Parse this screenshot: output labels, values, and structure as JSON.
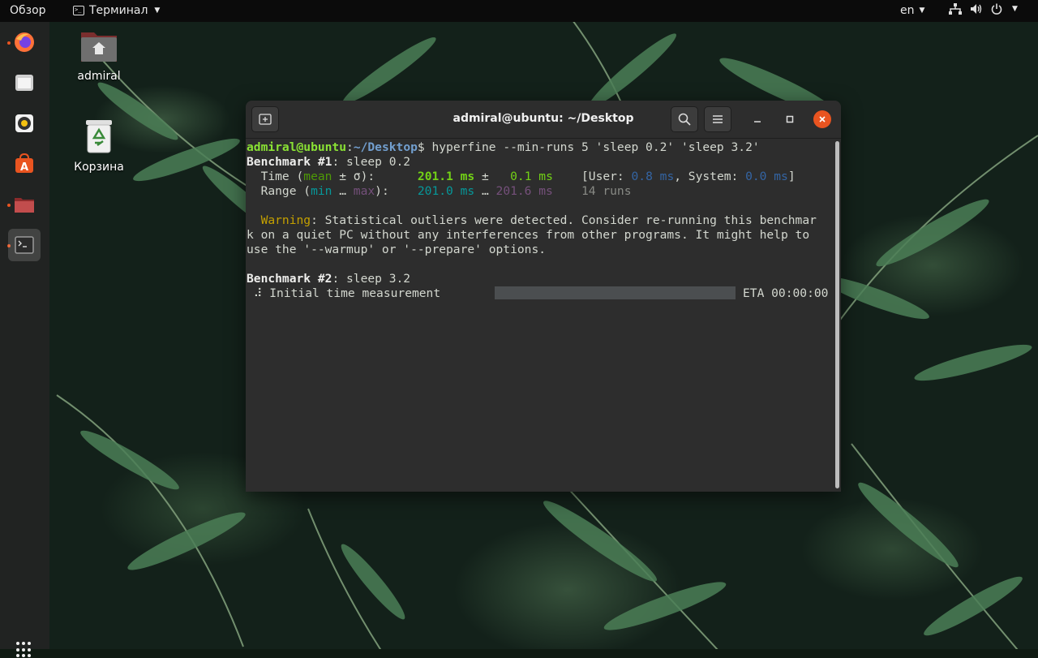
{
  "topbar": {
    "activities": "Обзор",
    "app_menu": "Терминал",
    "language": "en"
  },
  "desktop": {
    "icons": [
      {
        "label": "admiral",
        "icon": "home-folder-icon"
      },
      {
        "label": "Корзина",
        "icon": "trash-icon"
      }
    ]
  },
  "dock": {
    "items": [
      "firefox-icon",
      "files-icon",
      "rhythmbox-icon",
      "software-center-icon",
      "folder-icon",
      "terminal-icon"
    ],
    "show_apps": "apps-grid-icon"
  },
  "window": {
    "title": "admiral@ubuntu: ~/Desktop"
  },
  "terminal": {
    "prompt_user": "admiral@ubuntu",
    "prompt_sep": ":",
    "prompt_path": "~/Desktop",
    "prompt_dollar": "$",
    "command": " hyperfine --min-runs 5 'sleep 0.2' 'sleep 3.2'",
    "bench1_label": "Benchmark #1",
    "bench1_cmd": ": sleep 0.2",
    "time_label": "  Time (",
    "mean_word": "mean",
    "pm_sigma": " ± σ",
    "time_close": "):      ",
    "time_mean": "201.1 ms",
    "time_pm": " ±   ",
    "time_sigma": "0.1 ms",
    "user_open": "    [User: ",
    "user_val": "0.8 ms",
    "sys_label": ", System: ",
    "sys_val": "0.0 ms",
    "sys_close": "]",
    "range_label": "  Range (",
    "min_word": "min",
    "ellipsis": " … ",
    "max_word": "max",
    "range_close": "):    ",
    "range_min": "201.0 ms",
    "range_ell": " … ",
    "range_max": "201.6 ms",
    "runs": "    14 runs",
    "warning_word": "  Warning",
    "warning_l1": ": Statistical outliers were detected. Consider re-running this benchmar",
    "warning_l2": "k on a quiet PC without any interferences from other programs. It might help to",
    "warning_l3": "use the '--warmup' or '--prepare' options.",
    "bench2_label": "Benchmark #2",
    "bench2_cmd": ": sleep 3.2",
    "spinner_line": " ⠼ Initial time measurement",
    "eta": "ETA 00:00:00",
    "progress": 0.0
  }
}
